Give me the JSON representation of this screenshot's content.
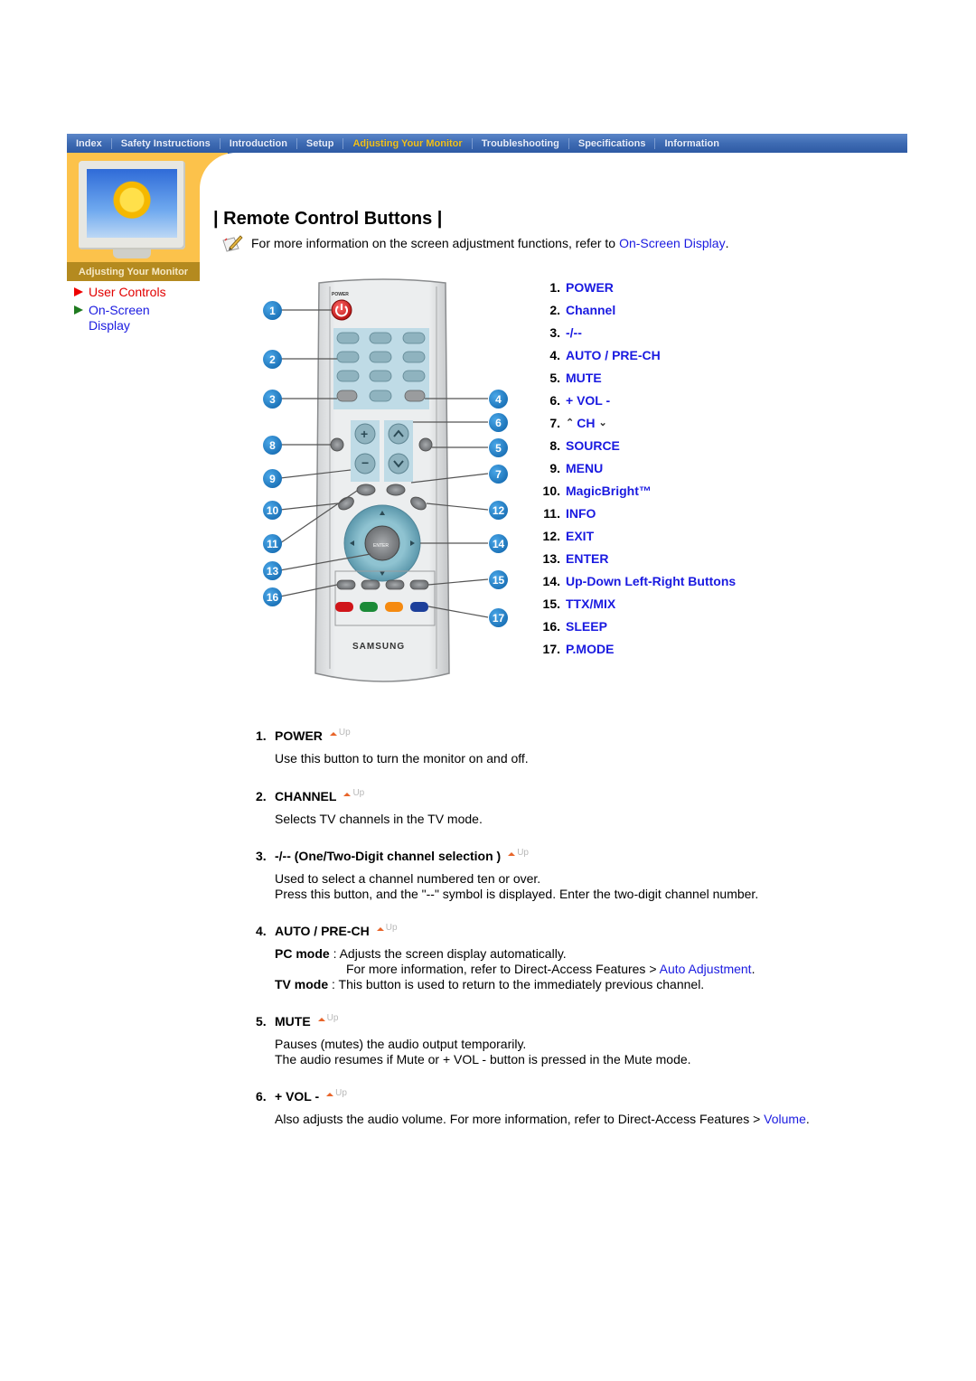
{
  "nav": {
    "items": [
      {
        "label": "Index",
        "active": false
      },
      {
        "label": "Safety Instructions",
        "active": false
      },
      {
        "label": "Introduction",
        "active": false
      },
      {
        "label": "Setup",
        "active": false
      },
      {
        "label": "Adjusting Your Monitor",
        "active": true
      },
      {
        "label": "Troubleshooting",
        "active": false
      },
      {
        "label": "Specifications",
        "active": false
      },
      {
        "label": "Information",
        "active": false
      }
    ]
  },
  "sidebar": {
    "caption": "Adjusting Your Monitor",
    "items": [
      {
        "label": "User Controls",
        "current": true
      },
      {
        "label": "On-Screen Display",
        "current": false
      }
    ]
  },
  "title": "| Remote Control Buttons |",
  "intro": {
    "text": "For more information on the screen adjustment functions, refer to ",
    "link": "On-Screen Display",
    "end": "."
  },
  "remote": {
    "brand": "SAMSUNG",
    "callouts": [
      "1",
      "2",
      "3",
      "4",
      "5",
      "6",
      "7",
      "8",
      "9",
      "10",
      "11",
      "12",
      "13",
      "14",
      "15",
      "16",
      "17"
    ],
    "color_buttons": [
      "#d0151a",
      "#1b8a37",
      "#f58a10",
      "#1c3f9a"
    ]
  },
  "button_list": [
    {
      "num": "1.",
      "label": "POWER"
    },
    {
      "num": "2.",
      "label": "Channel"
    },
    {
      "num": "3.",
      "label": "-/--"
    },
    {
      "num": "4.",
      "label": "AUTO / PRE-CH"
    },
    {
      "num": "5.",
      "label": "MUTE"
    },
    {
      "num": "6.",
      "label": "+ VOL -"
    },
    {
      "num": "7.",
      "label": "CH"
    },
    {
      "num": "8.",
      "label": "SOURCE"
    },
    {
      "num": "9.",
      "label": "MENU"
    },
    {
      "num": "10.",
      "label": "MagicBright™"
    },
    {
      "num": "11.",
      "label": "INFO"
    },
    {
      "num": "12.",
      "label": "EXIT"
    },
    {
      "num": "13.",
      "label": "ENTER"
    },
    {
      "num": "14.",
      "label": "Up-Down Left-Right Buttons"
    },
    {
      "num": "15.",
      "label": "TTX/MIX"
    },
    {
      "num": "16.",
      "label": "SLEEP"
    },
    {
      "num": "17.",
      "label": "P.MODE"
    }
  ],
  "up_label": "Up",
  "sections": {
    "power": {
      "num": "1.",
      "title": "POWER",
      "lines": [
        "Use this button to turn the monitor on and off."
      ]
    },
    "channel": {
      "num": "2.",
      "title": "CHANNEL",
      "lines": [
        "Selects TV channels in the TV mode."
      ]
    },
    "digit": {
      "num": "3.",
      "title": "-/-- (One/Two-Digit channel selection )",
      "lines": [
        "Used to select a channel numbered ten or over.",
        "Press this button, and the \"--\" symbol is displayed. Enter the two-digit channel number."
      ]
    },
    "auto": {
      "num": "4.",
      "title": "AUTO / PRE-CH",
      "pc_label": "PC mode",
      "pc_text": " : Adjusts the screen display automatically.",
      "pc_more": "For more information, refer to Direct-Access Features > ",
      "pc_link": "Auto Adjustment",
      "pc_end": ".",
      "tv_label": "TV mode",
      "tv_text": " : This button is used to return to the immediately previous channel."
    },
    "mute": {
      "num": "5.",
      "title": "MUTE",
      "lines": [
        "Pauses (mutes) the audio output temporarily.",
        "The audio resumes if Mute or + VOL - button is pressed in the Mute mode."
      ]
    },
    "vol": {
      "num": "6.",
      "title": "+ VOL -",
      "text": "Also adjusts the audio volume. For more information, refer to Direct-Access Features > ",
      "link": "Volume",
      "end": "."
    }
  }
}
